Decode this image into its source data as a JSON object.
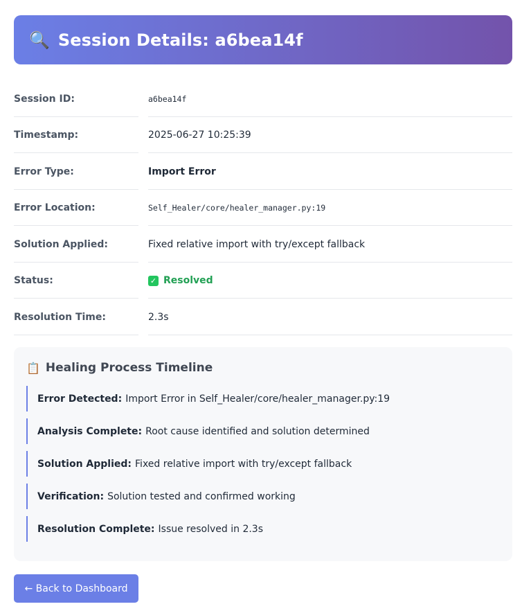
{
  "header": {
    "icon": "magnifying-glass-icon",
    "title": "Session Details: a6bea14f"
  },
  "details": [
    {
      "label": "Session ID:",
      "value": "a6bea14f"
    },
    {
      "label": "Timestamp:",
      "value": "2025-06-27 10:25:39"
    },
    {
      "label": "Error Type:",
      "value": "Import Error"
    },
    {
      "label": "Error Location:",
      "value": "Self_Healer/core/healer_manager.py:19"
    },
    {
      "label": "Solution Applied:",
      "value": "Fixed relative import with try/except fallback"
    },
    {
      "label": "Status:",
      "value": "Resolved",
      "icon": "check-mark-icon",
      "color": "#22a054"
    },
    {
      "label": "Resolution Time:",
      "value": "2.3s"
    }
  ],
  "timeline": {
    "icon": "clipboard-icon",
    "title": "Healing Process Timeline",
    "steps": [
      {
        "title": "Error Detected:",
        "text": "Import Error in Self_Healer/core/healer_manager.py:19"
      },
      {
        "title": "Analysis Complete:",
        "text": "Root cause identified and solution determined"
      },
      {
        "title": "Solution Applied:",
        "text": "Fixed relative import with try/except fallback"
      },
      {
        "title": "Verification:",
        "text": "Solution tested and confirmed working"
      },
      {
        "title": "Resolution Complete:",
        "text": "Issue resolved in 2.3s"
      }
    ]
  },
  "actions": {
    "back_label": "← Back to Dashboard"
  },
  "colors": {
    "accent": "#6b7fe6",
    "header_gradient_start": "#6b7fe6",
    "header_gradient_end": "#7353ab",
    "success": "#22a054"
  }
}
